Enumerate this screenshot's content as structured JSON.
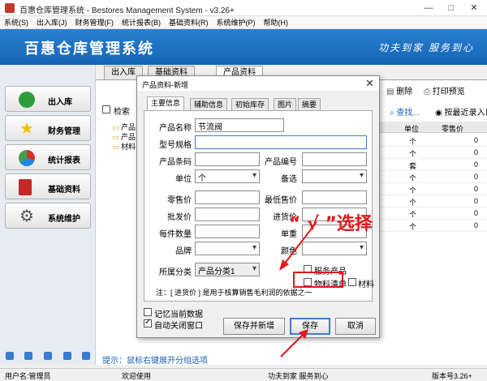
{
  "window": {
    "title": "百惠仓库管理系统 - Bestores Management System - v3.26+",
    "controls": [
      "—",
      "□",
      "✕"
    ]
  },
  "menu": [
    "系统(S)",
    "出入库(J)",
    "财务管理(F)",
    "统计报表(B)",
    "基础资料(R)",
    "系统维护(P)",
    "帮助(H)"
  ],
  "banner": {
    "name": "百惠仓库管理系统",
    "slogan": "功夫到家  服务到心"
  },
  "nav": [
    "出入库",
    "财务管理",
    "统计报表",
    "基础资料",
    "系统维护"
  ],
  "tabs": [
    "出入库",
    "基础资料",
    "产品资料"
  ],
  "toolbar": {
    "delete": "删除",
    "print_preview": "打印预览",
    "search": "查找...",
    "recent": "按最近录入日"
  },
  "left_content": {
    "checkbox": "检索",
    "tree": [
      "产品",
      "产品",
      "材料"
    ]
  },
  "grid": {
    "headers": [
      "单位",
      "零售价"
    ],
    "rows": [
      [
        "个",
        "0"
      ],
      [
        "个",
        "0"
      ],
      [
        "套",
        "0"
      ],
      [
        "个",
        "0"
      ],
      [
        "个",
        "0"
      ],
      [
        "个",
        "0"
      ],
      [
        "个",
        "0"
      ],
      [
        "个",
        "0"
      ]
    ]
  },
  "hint": "提示：鼠标右键展开分组选项",
  "statusbar": {
    "user": "用户名:管理员",
    "welcome": "欢迎使用",
    "slogan": "功夫到家 服务到心",
    "version": "版本号3.26+"
  },
  "dialog": {
    "title": "产品资料-新增",
    "tabs": [
      "主要信息",
      "辅助信息",
      "初始库存",
      "图片",
      "摘要"
    ],
    "fields": {
      "name_label": "产品名称",
      "name_value": "节流阀",
      "spec_label": "型号规格",
      "spec_value": "",
      "barcode_label": "产品条码",
      "barcode_value": "",
      "code_label": "产品编号",
      "code_value": "",
      "unit_label": "单位",
      "unit_value": "个",
      "option_label": "备选",
      "option_value": "",
      "retail_label": "零售价",
      "retail_value": "",
      "min_price_label": "最低售价",
      "min_price_value": "",
      "wholesale_label": "批发价",
      "wholesale_value": "",
      "purchase_label": "进货价",
      "purchase_value": "",
      "pcs_label": "每件数量",
      "pcs_value": "",
      "weight_label": "单重",
      "weight_value": "",
      "brand_label": "品牌",
      "brand_value": "",
      "color_label": "颜色",
      "color_value": "",
      "category_label": "所属分类",
      "category_value": "产品分类1"
    },
    "checks": {
      "service": "服务产品",
      "bom": "物料清单",
      "material": "材料"
    },
    "note": "注：[ 进货价 ] 是用于核算销售毛利润的依据之一",
    "bottom_checks": {
      "remember": "记忆当前数据",
      "autoclose": "自动关闭窗口"
    },
    "buttons": {
      "save_new": "保存并新增",
      "save": "保存",
      "cancel": "取消"
    }
  },
  "annotation": "“ √ ”选择",
  "colors": {
    "banner": "#1a6fc4",
    "accent_red": "#e3171a",
    "hint_blue": "#1a5fb4"
  }
}
